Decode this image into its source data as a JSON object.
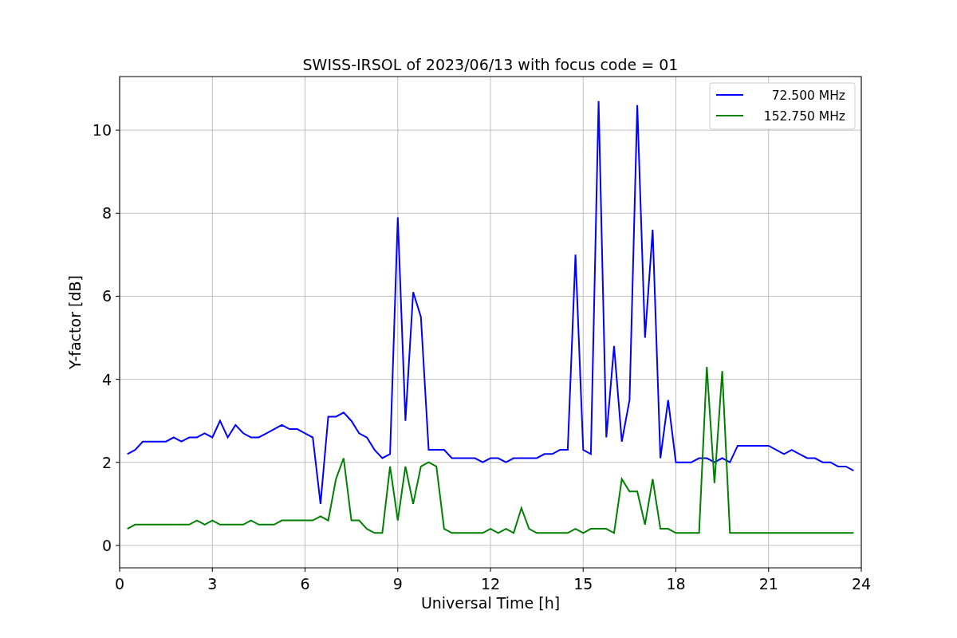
{
  "chart_data": {
    "type": "line",
    "title": "SWISS-IRSOL of 2023/06/13 with focus code = 01",
    "xlabel": "Universal Time [h]",
    "ylabel": "Y-factor [dB]",
    "x": [
      0.25,
      0.5,
      0.75,
      1,
      1.25,
      1.5,
      1.75,
      2,
      2.25,
      2.5,
      2.75,
      3,
      3.25,
      3.5,
      3.75,
      4,
      4.25,
      4.5,
      4.75,
      5,
      5.25,
      5.5,
      5.75,
      6,
      6.25,
      6.5,
      6.75,
      7,
      7.25,
      7.5,
      7.75,
      8,
      8.25,
      8.5,
      8.75,
      9,
      9.25,
      9.5,
      9.75,
      10,
      10.25,
      10.5,
      10.75,
      11,
      11.25,
      11.5,
      11.75,
      12,
      12.25,
      12.5,
      12.75,
      13,
      13.25,
      13.5,
      13.75,
      14,
      14.25,
      14.5,
      14.75,
      15,
      15.25,
      15.5,
      15.75,
      16,
      16.25,
      16.5,
      16.75,
      17,
      17.25,
      17.5,
      17.75,
      18,
      18.25,
      18.5,
      18.75,
      19,
      19.25,
      19.5,
      19.75,
      20,
      20.25,
      20.5,
      20.75,
      21,
      21.25,
      21.5,
      21.75,
      22,
      22.25,
      22.5,
      22.75,
      23,
      23.25,
      23.5,
      23.75
    ],
    "series": [
      {
        "name": "72.500 MHz",
        "color": "#0000ff",
        "values": [
          2.2,
          2.3,
          2.5,
          2.5,
          2.5,
          2.5,
          2.6,
          2.5,
          2.6,
          2.6,
          2.7,
          2.6,
          3.0,
          2.6,
          2.9,
          2.7,
          2.6,
          2.6,
          2.7,
          2.8,
          2.9,
          2.8,
          2.8,
          2.7,
          2.6,
          1.0,
          3.1,
          3.1,
          3.2,
          3.0,
          2.7,
          2.6,
          2.3,
          2.1,
          2.2,
          7.9,
          3.0,
          6.1,
          5.5,
          2.3,
          2.3,
          2.3,
          2.1,
          2.1,
          2.1,
          2.1,
          2.0,
          2.1,
          2.1,
          2.0,
          2.1,
          2.1,
          2.1,
          2.1,
          2.2,
          2.2,
          2.3,
          2.3,
          7.0,
          2.3,
          2.2,
          10.7,
          2.6,
          4.8,
          2.5,
          3.5,
          10.6,
          5.0,
          7.6,
          2.1,
          3.5,
          2.0,
          2.0,
          2.0,
          2.1,
          2.1,
          2.0,
          2.1,
          2.0,
          2.4,
          2.4,
          2.4,
          2.4,
          2.4,
          2.3,
          2.2,
          2.3,
          2.2,
          2.1,
          2.1,
          2.0,
          2.0,
          1.9,
          1.9,
          1.8
        ]
      },
      {
        "name": "152.750 MHz",
        "color": "#008000",
        "values": [
          0.4,
          0.5,
          0.5,
          0.5,
          0.5,
          0.5,
          0.5,
          0.5,
          0.5,
          0.6,
          0.5,
          0.6,
          0.5,
          0.5,
          0.5,
          0.5,
          0.6,
          0.5,
          0.5,
          0.5,
          0.6,
          0.6,
          0.6,
          0.6,
          0.6,
          0.7,
          0.6,
          1.6,
          2.1,
          0.6,
          0.6,
          0.4,
          0.3,
          0.3,
          1.9,
          0.6,
          1.9,
          1.0,
          1.9,
          2.0,
          1.9,
          0.4,
          0.3,
          0.3,
          0.3,
          0.3,
          0.3,
          0.4,
          0.3,
          0.4,
          0.3,
          0.9,
          0.4,
          0.3,
          0.3,
          0.3,
          0.3,
          0.3,
          0.4,
          0.3,
          0.4,
          0.4,
          0.4,
          0.3,
          1.6,
          1.3,
          1.3,
          0.5,
          1.6,
          0.4,
          0.4,
          0.3,
          0.3,
          0.3,
          0.3,
          4.3,
          1.5,
          4.2,
          0.3,
          0.3,
          0.3,
          0.3,
          0.3,
          0.3,
          0.3,
          0.3,
          0.3,
          0.3,
          0.3,
          0.3,
          0.3,
          0.3,
          0.3,
          0.3,
          0.3
        ]
      }
    ],
    "xlim": [
      0,
      24
    ],
    "ylim": [
      -0.54,
      11.29
    ],
    "xticks": [
      0,
      3,
      6,
      9,
      12,
      15,
      18,
      21,
      24
    ],
    "yticks": [
      0,
      2,
      4,
      6,
      8,
      10
    ],
    "grid": true,
    "legend": "upper right"
  }
}
